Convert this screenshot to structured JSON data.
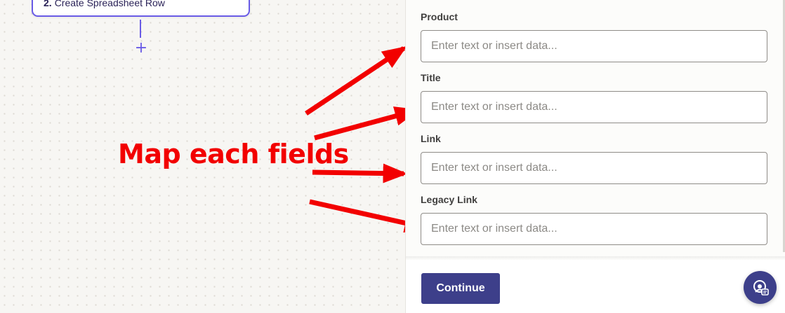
{
  "canvas": {
    "step_card": {
      "number": "2.",
      "title": "Create Spreadsheet Row"
    },
    "add_step_symbol": "+",
    "annotation": "Map each fields"
  },
  "panel": {
    "fields": [
      {
        "label": "Product",
        "placeholder": "Enter text or insert data..."
      },
      {
        "label": "Title",
        "placeholder": "Enter text or insert data..."
      },
      {
        "label": "Link",
        "placeholder": "Enter text or insert data..."
      },
      {
        "label": "Legacy Link",
        "placeholder": "Enter text or insert data..."
      }
    ],
    "continue_label": "Continue",
    "help_icon": "support-chat-icon"
  },
  "colors": {
    "accent": "#695be6",
    "button": "#3d3f8a",
    "annotation": "#f20000"
  }
}
